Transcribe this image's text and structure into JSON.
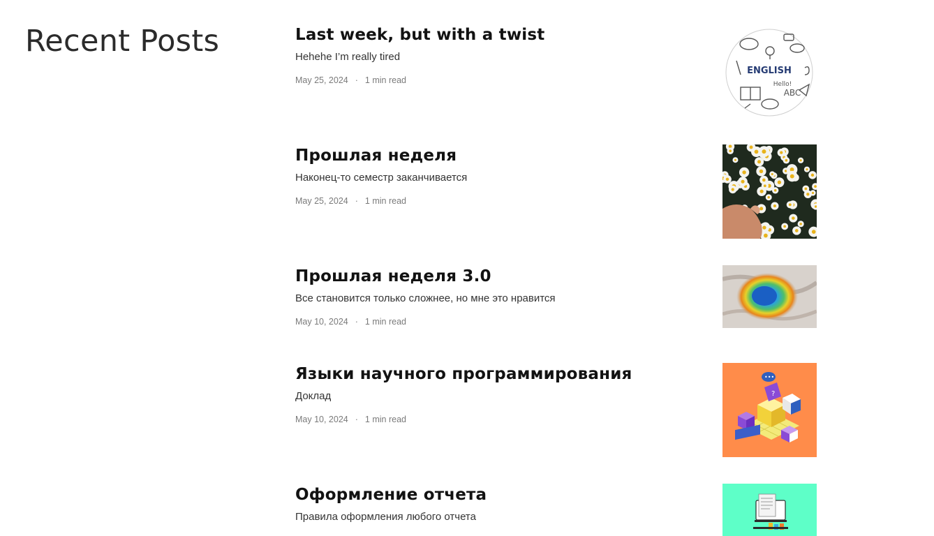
{
  "section": {
    "title": "Recent Posts"
  },
  "posts": [
    {
      "title": "Last week, but with a twist",
      "excerpt": "Hehehe I’m really tired",
      "date": "May 25, 2024",
      "separator": "·",
      "read_time": "1 min read",
      "thumbnail": {
        "icon": "english-doodle-icon",
        "text": "ENGLISH",
        "abc": "ABC",
        "hello": "Hello!"
      }
    },
    {
      "title": "Прошлая неделя",
      "excerpt": "Наконец-то семестр заканчивается",
      "date": "May 25, 2024",
      "separator": "·",
      "read_time": "1 min read",
      "thumbnail": {
        "icon": "daisies-photo-icon"
      }
    },
    {
      "title": "Прошлая неделя 3.0",
      "excerpt": "Все становится только сложнее, но мне это нравится",
      "date": "May 10, 2024",
      "separator": "·",
      "read_time": "1 min read",
      "thumbnail": {
        "icon": "hot-spring-aerial-icon"
      }
    },
    {
      "title": "Языки научного программирования",
      "excerpt": "Доклад",
      "date": "May 10, 2024",
      "separator": "·",
      "read_time": "1 min read",
      "thumbnail": {
        "icon": "isometric-cubes-illustration-icon"
      }
    },
    {
      "title": "Оформление отчета",
      "excerpt": "Правила оформления любого отчета",
      "date": "",
      "separator": "",
      "read_time": "",
      "thumbnail": {
        "icon": "document-monitor-illustration-icon"
      }
    }
  ]
}
